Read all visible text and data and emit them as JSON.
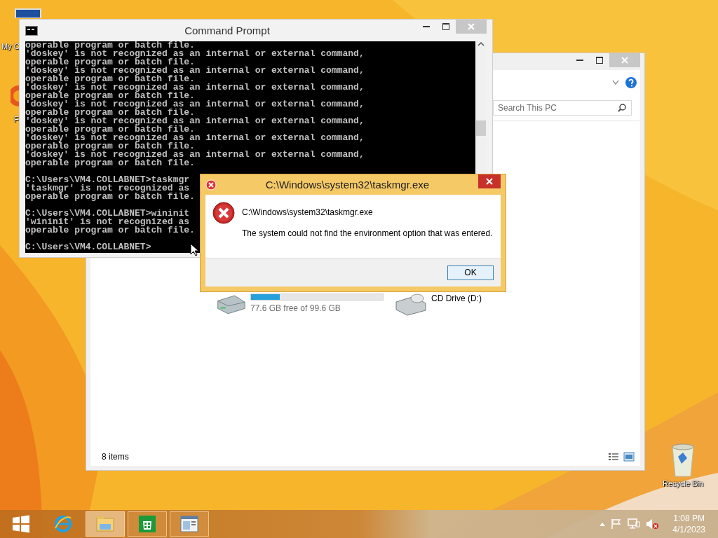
{
  "desktop": {
    "icons": [
      {
        "kind": "computer",
        "label": "My C"
      },
      {
        "kind": "browser",
        "label": "F"
      },
      {
        "kind": "recycle",
        "label": "Recycle Bin"
      }
    ]
  },
  "explorer": {
    "search": {
      "placeholder": "Search This PC"
    },
    "drives": [
      {
        "kind": "disk",
        "level": 0.22,
        "free": "77.6 GB free of 99.6 GB"
      },
      {
        "kind": "cd",
        "name": "CD Drive (D:)"
      }
    ],
    "status": "8 items"
  },
  "cmd": {
    "title": "Command Prompt",
    "blocks": [
      [
        "operable program or batch file.",
        "'doskey' is not recognized as an internal or external command,",
        "operable program or batch file.",
        "'doskey' is not recognized as an internal or external command,",
        "operable program or batch file.",
        "'doskey' is not recognized as an internal or external command,",
        "operable program or batch file.",
        "'doskey' is not recognized as an internal or external command,",
        "operable program or batch file.",
        "'doskey' is not recognized as an internal or external command,",
        "operable program or batch file.",
        "'doskey' is not recognized as an internal or external command,",
        "operable program or batch file.",
        "'doskey' is not recognized as an internal or external command,",
        "operable program or batch file."
      ],
      [
        "C:\\Users\\VM4.COLLABNET>taskmgr",
        "'taskmgr' is not recognized as",
        "operable program or batch file."
      ],
      [
        "C:\\Users\\VM4.COLLABNET>wininit",
        "'wininit' is not recognized as",
        "operable program or batch file."
      ],
      [
        "C:\\Users\\VM4.COLLABNET>"
      ]
    ]
  },
  "dialog": {
    "title": "C:\\Windows\\system32\\taskmgr.exe",
    "heading": "C:\\Windows\\system32\\taskmgr.exe",
    "message": "The system could not find the environment option that was entered.",
    "buttons": [
      "OK"
    ]
  },
  "taskbar": {
    "items": [
      {
        "kind": "start",
        "running": false,
        "selected": false
      },
      {
        "kind": "ie",
        "running": false,
        "selected": false
      },
      {
        "kind": "explorer",
        "running": true,
        "selected": true
      },
      {
        "kind": "store",
        "running": true,
        "selected": false
      },
      {
        "kind": "app",
        "running": true,
        "selected": false
      }
    ],
    "clock": {
      "time": "1:08 PM",
      "date": "4/1/2023"
    }
  }
}
